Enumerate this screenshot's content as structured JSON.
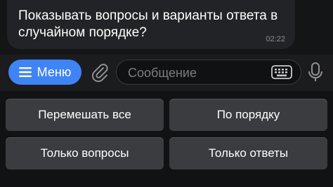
{
  "message": {
    "text": "Показывать вопросы и варианты ответа в случайном порядке?",
    "time": "02:22"
  },
  "input_bar": {
    "menu_label": "Меню",
    "placeholder": "Сообщение",
    "icons": [
      "menu-icon",
      "paperclip-icon",
      "keyboard-icon",
      "microphone-icon"
    ]
  },
  "keyboard": {
    "buttons": [
      {
        "label": "Перемешать все"
      },
      {
        "label": "По порядку"
      },
      {
        "label": "Только вопросы"
      },
      {
        "label": "Только ответы"
      }
    ]
  },
  "colors": {
    "accent": "#3f84f5",
    "bubble": "#222326",
    "button": "#3b3c40"
  }
}
